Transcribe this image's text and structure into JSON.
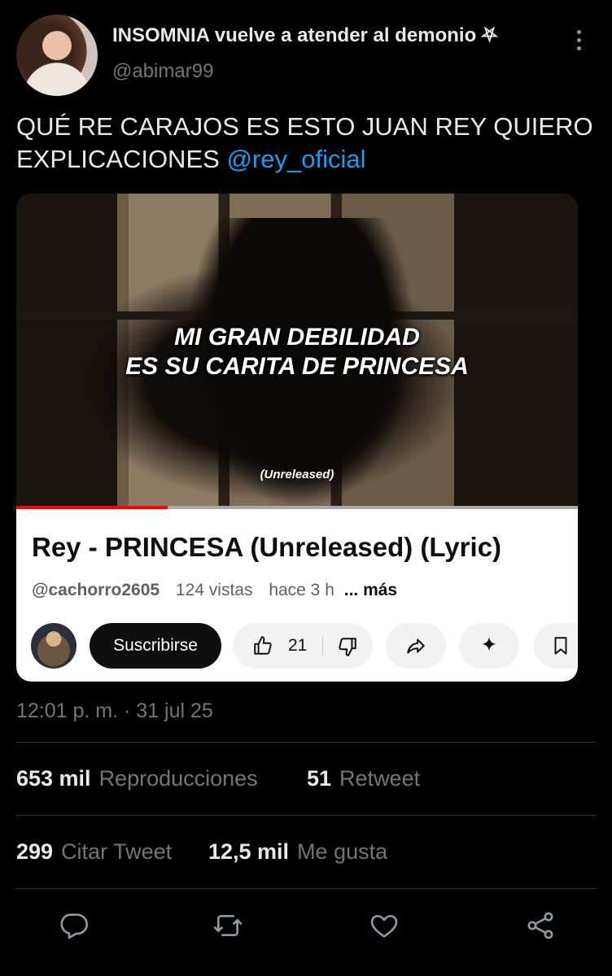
{
  "author": {
    "display_name": "INSOMNIA vuelve a atender al demonio ⛧",
    "handle": "@abimar99"
  },
  "tweet": {
    "text": "QUÉ RE CARAJOS ES ESTO JUAN REY QUIERO EXPLICACIONES",
    "mention": "@rey_oficial"
  },
  "video": {
    "lyric_line1": "MI GRAN DEBILIDAD",
    "lyric_line2": "ES SU CARITA DE PRINCESA",
    "watermark": "(Unreleased)",
    "progress": 0.27
  },
  "youtube": {
    "title": "Rey - PRINCESA (Unreleased) (Lyric)",
    "channel": "@cachorro2605",
    "views": "124 vistas",
    "age": "hace 3 h",
    "more": "... más",
    "subscribe": "Suscribirse",
    "likes": "21",
    "icons": [
      "thumbs-up-icon",
      "thumbs-down-icon",
      "share-icon",
      "sparkle-icon",
      "bookmark-icon"
    ],
    "accent": "#ff0000"
  },
  "timestamp": "12:01 p. m. · 31 jul 25",
  "stats": {
    "views_count": "653 mil",
    "views_label": "Reproducciones",
    "retweets_count": "51",
    "retweets_label": "Retweet",
    "quotes_count": "299",
    "quotes_label": "Citar Tweet",
    "likes_count": "12,5 mil",
    "likes_label": "Me gusta"
  },
  "actions": [
    "reply-icon",
    "retweet-icon",
    "like-icon",
    "share-icon"
  ],
  "colors": {
    "background": "#000000",
    "link": "#1d9bf0",
    "muted": "#71767b"
  }
}
